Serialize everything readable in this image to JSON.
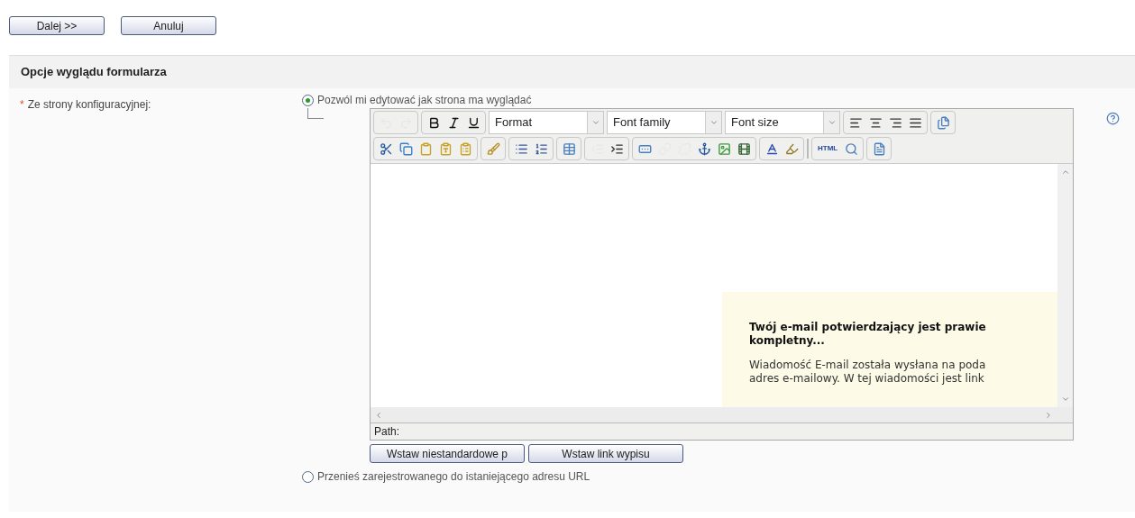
{
  "actions": [
    {
      "label": "Dalej >>"
    },
    {
      "label": "Anuluj"
    }
  ],
  "section": {
    "title": "Opcje wyglądu formularza"
  },
  "field": {
    "required_mark": "*",
    "label": "Ze strony konfiguracyjnej:"
  },
  "options": [
    {
      "label": "Pozwól mi edytować jak strona ma wyglądać",
      "selected": true
    },
    {
      "label": "Przenieś zarejestrowanego do istaniejącego adresu URL",
      "selected": false
    }
  ],
  "editor": {
    "toolbar_1": [
      {
        "kind": "undo",
        "disabled": true
      },
      {
        "kind": "redo",
        "disabled": true
      },
      {
        "kind": "bold",
        "disabled": false
      },
      {
        "kind": "italic",
        "disabled": false
      },
      {
        "kind": "underline",
        "disabled": false
      }
    ],
    "dropdowns": [
      {
        "label": "Format"
      },
      {
        "label": "Font family"
      },
      {
        "label": "Font size"
      }
    ],
    "toolbar_1b": [
      {
        "kind": "align-left",
        "disabled": false
      },
      {
        "kind": "align-center",
        "disabled": false
      },
      {
        "kind": "align-right",
        "disabled": false
      },
      {
        "kind": "justify",
        "disabled": false
      },
      {
        "kind": "template",
        "disabled": false
      }
    ],
    "toolbar_2": [
      {
        "kind": "cut",
        "disabled": false
      },
      {
        "kind": "copy",
        "disabled": false
      },
      {
        "kind": "paste",
        "disabled": false
      },
      {
        "kind": "paste-text",
        "disabled": false
      },
      {
        "kind": "paste-word",
        "disabled": false
      },
      {
        "kind": "cleanup",
        "disabled": false
      },
      {
        "kind": "bullets",
        "disabled": false
      },
      {
        "kind": "numbers",
        "disabled": false
      },
      {
        "kind": "edit-table",
        "disabled": false
      },
      {
        "kind": "outdent",
        "disabled": true
      },
      {
        "kind": "indent",
        "disabled": false
      },
      {
        "kind": "form",
        "disabled": false
      },
      {
        "kind": "link",
        "disabled": true
      },
      {
        "kind": "unlink",
        "disabled": true
      },
      {
        "kind": "anchor",
        "disabled": false
      },
      {
        "kind": "image",
        "disabled": false
      },
      {
        "kind": "media",
        "disabled": false
      },
      {
        "kind": "text-color",
        "disabled": false
      },
      {
        "kind": "highlight",
        "disabled": false
      },
      {
        "kind": "html",
        "disabled": false
      },
      {
        "kind": "preview",
        "disabled": false
      },
      {
        "kind": "document",
        "disabled": false
      }
    ],
    "html_label": "HTML",
    "preview": {
      "heading": "Twój e-mail potwierdzający jest prawie kompletny...",
      "lines": [
        "Wiadomość E-mail została wysłana na poda",
        "adres e-mailowy. W tej wiadomości jest link"
      ]
    },
    "path_label": "Path:",
    "buttons": [
      {
        "label": "Wstaw niestandardowe p"
      },
      {
        "label": "Wstaw link wypisu"
      }
    ]
  }
}
